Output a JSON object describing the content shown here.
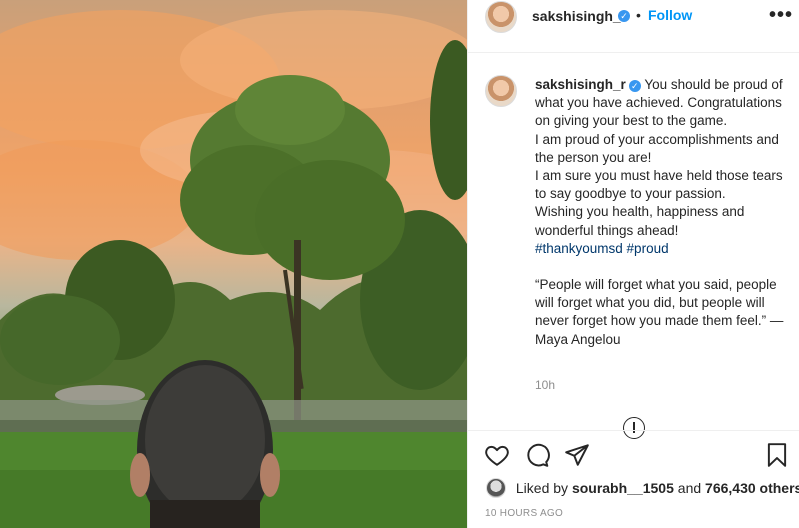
{
  "post": {
    "image_alt": "Man from behind looking at sunset sky over trees",
    "header": {
      "username": "sakshisingh_r",
      "separator": "•",
      "follow_label": "Follow",
      "more_icon": "more-horizontal-icon",
      "verified_glyph": "✓"
    },
    "caption": {
      "username": "sakshisingh_r",
      "lines": [
        "You should be proud of what you have achieved.",
        "Congratulations on giving your best to the game.",
        "I am proud of your accomplishments and the person you are!",
        "I am sure you must have held those tears to say goodbye to your passion.",
        "Wishing you health, happiness and wonderful things ahead!"
      ],
      "hashtags": "#thankyoumsd #proud",
      "quote": "“People will forget what you said, people will forget what you did, but people will never forget how you made them feel.” — Maya Angelou",
      "time": "10h"
    },
    "actions": {
      "like_icon": "heart-icon",
      "comment_icon": "comment-icon",
      "share_icon": "send-icon",
      "save_icon": "bookmark-icon"
    },
    "likes": {
      "prefix": "Liked by",
      "user": "sourabh__1505",
      "joiner": "and",
      "others": "766,430 others"
    },
    "posted_ago": "10 HOURS AGO"
  },
  "colors": {
    "accent": "#0095f6",
    "verified": "#3897f0",
    "hashtag": "#00376b",
    "muted": "#8e8e8e"
  }
}
